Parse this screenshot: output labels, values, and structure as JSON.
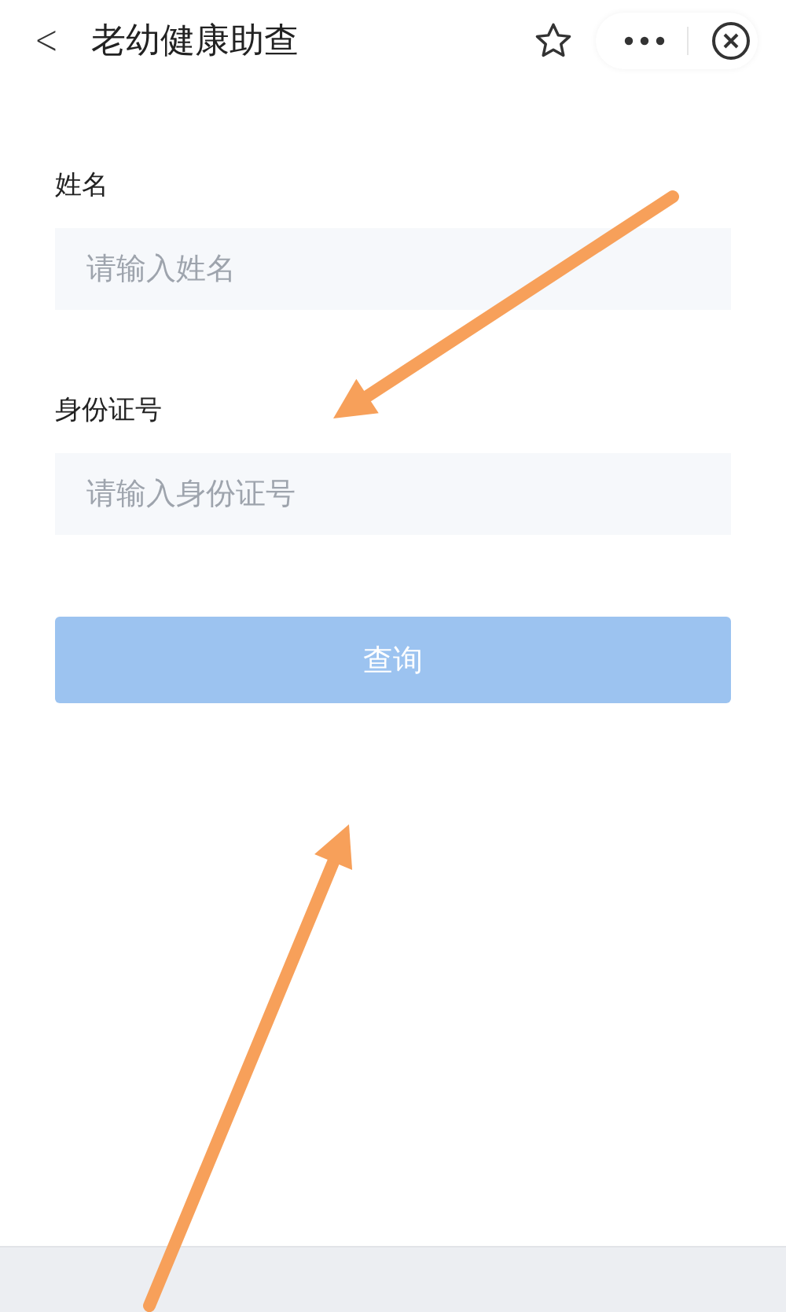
{
  "nav_bar": {
    "back": "<",
    "title": "老幼健康助查"
  },
  "form": {
    "fields": [
      {
        "label": "姓名",
        "placeholder": "请输入姓名"
      },
      {
        "label": "身份证号",
        "placeholder": "请输入身份证号"
      }
    ],
    "submit": {
      "label": "查询",
      "disabled": true
    }
  },
  "annotations": [
    {
      "kind": "arrow"
    },
    {
      "kind": "arrow"
    }
  ]
}
